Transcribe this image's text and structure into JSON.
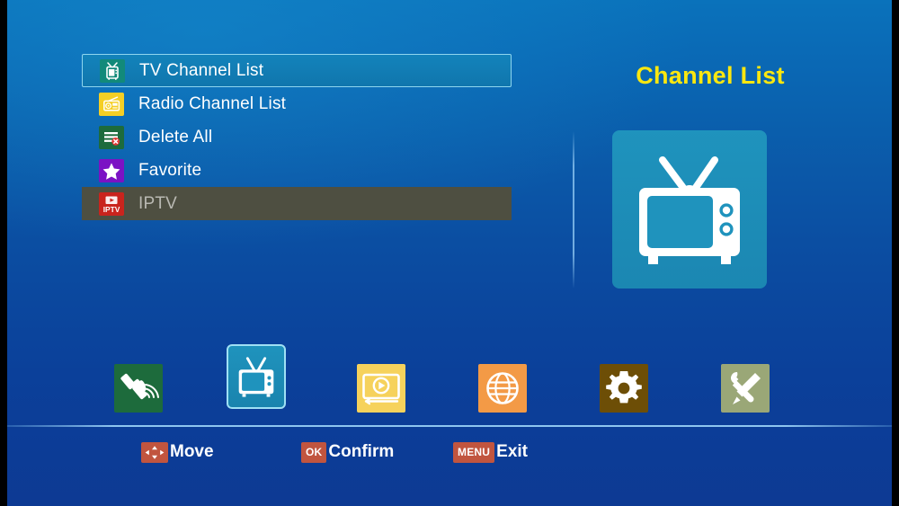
{
  "screen": {
    "title": "Channel List",
    "accent_yellow": "#fbe70f",
    "background_top": "#0a72bb",
    "background_bottom": "#0c3a93"
  },
  "menu": {
    "items": [
      {
        "label": "TV Channel List",
        "icon": "tv-icon",
        "state": "selected"
      },
      {
        "label": "Radio Channel List",
        "icon": "radio-icon",
        "state": "normal"
      },
      {
        "label": "Delete All",
        "icon": "delete-icon",
        "state": "normal"
      },
      {
        "label": "Favorite",
        "icon": "star-icon",
        "state": "normal"
      },
      {
        "label": "IPTV",
        "icon": "iptv-icon",
        "state": "disabled"
      }
    ]
  },
  "preview": {
    "title": "Channel List",
    "icon": "tv-large-icon"
  },
  "iconbar": {
    "items": [
      {
        "icon": "satellite-icon",
        "state": "normal"
      },
      {
        "icon": "tv-icon",
        "state": "active"
      },
      {
        "icon": "media-player-icon",
        "state": "normal"
      },
      {
        "icon": "globe-icon",
        "state": "normal"
      },
      {
        "icon": "gear-icon",
        "state": "normal"
      },
      {
        "icon": "tools-icon",
        "state": "normal"
      }
    ]
  },
  "hints": [
    {
      "key": "",
      "key_icon": "dpad-icon",
      "label": "Move"
    },
    {
      "key": "OK",
      "key_icon": "",
      "label": "Confirm"
    },
    {
      "key": "MENU",
      "key_icon": "",
      "label": "Exit"
    }
  ]
}
